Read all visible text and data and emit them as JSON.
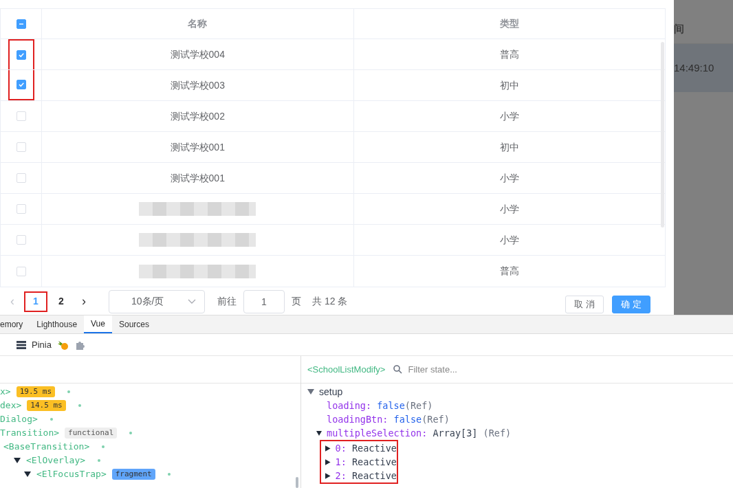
{
  "table": {
    "header_checkbox": {
      "indeterminate": true
    },
    "columns": [
      "名称",
      "类型"
    ],
    "rows": [
      {
        "name": "测试学校004",
        "type": "普高",
        "checked": true,
        "highlighted": true,
        "redacted": false
      },
      {
        "name": "测试学校003",
        "type": "初中",
        "checked": true,
        "highlighted": true,
        "redacted": false
      },
      {
        "name": "测试学校002",
        "type": "小学",
        "checked": false,
        "highlighted": false,
        "redacted": false
      },
      {
        "name": "测试学校001",
        "type": "初中",
        "checked": false,
        "highlighted": false,
        "redacted": false
      },
      {
        "name": "测试学校001",
        "type": "小学",
        "checked": false,
        "highlighted": false,
        "redacted": false
      },
      {
        "type": "小学",
        "checked": false,
        "highlighted": false,
        "redacted": true
      },
      {
        "type": "小学",
        "checked": false,
        "highlighted": false,
        "redacted": true
      },
      {
        "type": "普高",
        "checked": false,
        "highlighted": false,
        "redacted": true
      }
    ]
  },
  "pagination": {
    "prev": "‹",
    "pages": [
      {
        "label": "1",
        "selected": true,
        "highlighted": true
      },
      {
        "label": "2",
        "selected": false,
        "highlighted": false
      }
    ],
    "next": "›",
    "page_size": "10条/页",
    "goto_label": "前往",
    "goto_value": "1",
    "page_unit": "页",
    "total": "共 12 条"
  },
  "buttons": [
    {
      "label": "取 消",
      "kind": "default"
    },
    {
      "label": "确 定",
      "kind": "primary"
    }
  ],
  "background": {
    "column_header": "间",
    "cell": "14:49:10"
  },
  "devtools": {
    "tabs": [
      {
        "label": "emory",
        "selected": false
      },
      {
        "label": "Lighthouse",
        "selected": false
      },
      {
        "label": "Vue",
        "selected": true
      },
      {
        "label": "Sources",
        "selected": false
      }
    ],
    "toolbar": {
      "label": "Pinia"
    },
    "component_tree": [
      {
        "label": "x>",
        "badge": "19.5 ms",
        "color": "#fbbf24"
      },
      {
        "label": "dex>",
        "badge": "14.5 ms",
        "color": "#fbbf24"
      },
      {
        "label": "Dialog>"
      },
      {
        "label": "Transition>",
        "badge": "functional",
        "color": "#eeeeee",
        "children": [
          {
            "label": "<BaseTransition>",
            "children": [
              {
                "label": "<ElOverlay>",
                "expanded": true,
                "children": [
                  {
                    "label": "<ElFocusTrap>",
                    "expanded": true,
                    "badge": "fragment",
                    "color": "#60a5fa"
                  }
                ]
              }
            ]
          }
        ]
      }
    ],
    "inspector": {
      "component": "<SchoolListModify>",
      "filter_placeholder": "Filter state...",
      "section": "setup",
      "section_expanded": true,
      "fields": [
        {
          "key": "loading:",
          "value": "false",
          "suffix": "(Ref)"
        },
        {
          "key": "loadingBtn:",
          "value": "false",
          "suffix": "(Ref)"
        },
        {
          "key": "multipleSelection:",
          "value": "Array[3]",
          "suffix": "(Ref)",
          "expanded": true,
          "children_highlighted": true,
          "children": [
            {
              "key": "0:",
              "value": "Reactive",
              "expanded": false
            },
            {
              "key": "1:",
              "value": "Reactive",
              "expanded": false
            },
            {
              "key": "2:",
              "value": "Reactive",
              "expanded": false
            }
          ]
        }
      ]
    }
  }
}
